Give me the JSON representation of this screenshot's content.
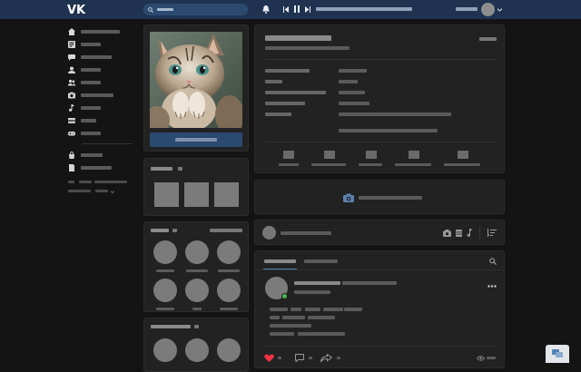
{
  "colors": {
    "topbar": "#1f3350",
    "page_bg": "#141414",
    "card_bg": "#222222",
    "placeholder": "#5a5a5a",
    "accent": "#5181b8",
    "online": "#4bb34b",
    "like": "#ff3347"
  },
  "topbar": {
    "logo": "VK",
    "logo_icon": "vk-logo-icon",
    "search_icon": "search-icon",
    "bell_icon": "bell-icon",
    "player_icons": [
      "prev-icon",
      "pause-icon",
      "next-icon"
    ],
    "menu_chevron_icon": "chevron-down-icon"
  },
  "sidebar": {
    "items": [
      {
        "icon": "home-icon"
      },
      {
        "icon": "news-icon"
      },
      {
        "icon": "messages-icon"
      },
      {
        "icon": "friends-icon"
      },
      {
        "icon": "communities-icon"
      },
      {
        "icon": "photos-icon"
      },
      {
        "icon": "music-icon"
      },
      {
        "icon": "videos-icon"
      },
      {
        "icon": "games-icon"
      },
      {
        "icon": "market-icon"
      },
      {
        "icon": "documents-icon"
      }
    ]
  },
  "profile": {
    "avatar": "profile-photo-kitten"
  },
  "friends": {
    "count_label": "",
    "grid_count": 6
  },
  "post_bar": {
    "icons": [
      "camera-icon",
      "video-icon",
      "music-icon",
      "sort-icon"
    ]
  },
  "post": {
    "actions": [
      "like-icon",
      "comment-icon",
      "share-icon",
      "views-icon"
    ]
  },
  "corner": {
    "icon": "chat-icon"
  }
}
